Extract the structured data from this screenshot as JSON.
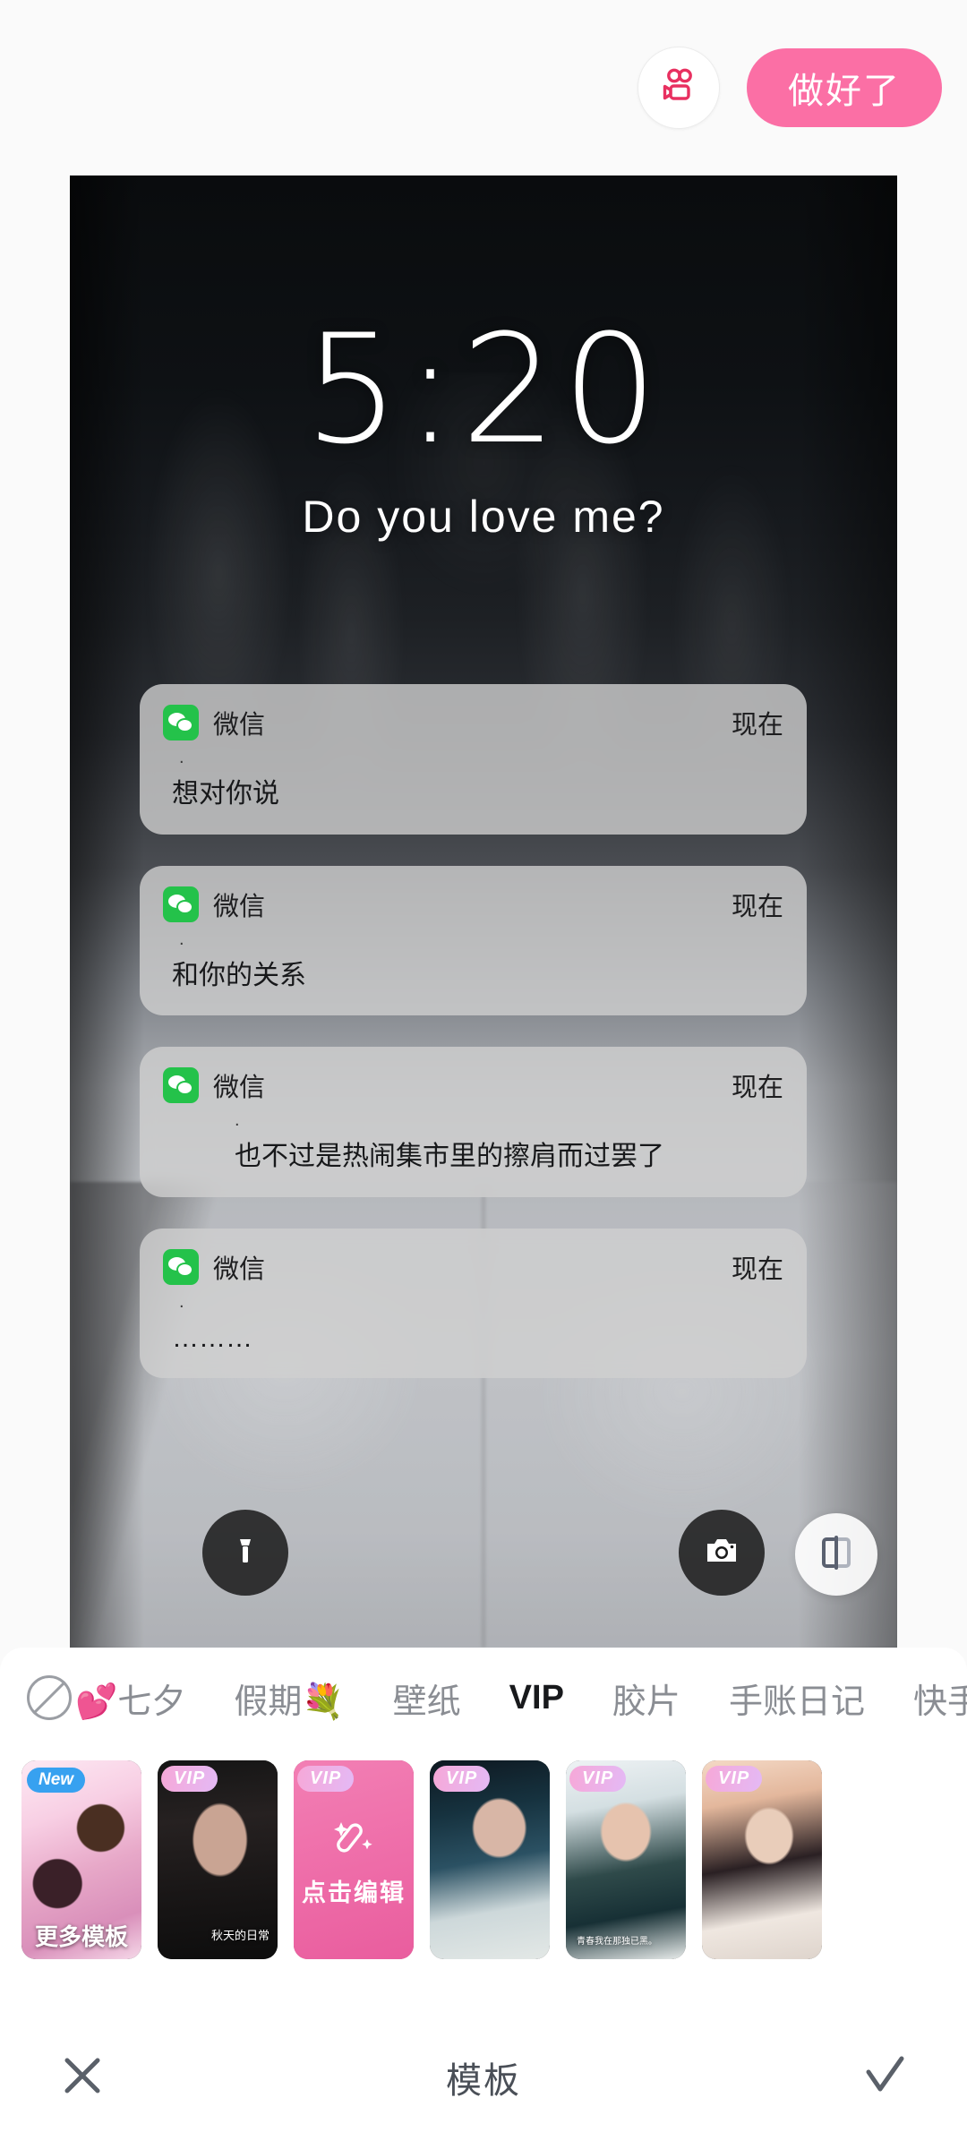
{
  "topbar": {
    "video_icon": "video-camera-icon",
    "done_label": "做好了"
  },
  "preview": {
    "lock_time": "5:20",
    "lock_subtitle": "Do you love me?",
    "notifications": [
      {
        "app": "微信",
        "time": "现在",
        "dot": ".",
        "body": "想对你说",
        "indent": "indent-1"
      },
      {
        "app": "微信",
        "time": "现在",
        "dot": ".",
        "body": "和你的关系",
        "indent": "indent-1"
      },
      {
        "app": "微信",
        "time": "现在",
        "dot": ".",
        "body": "也不过是热闹集市里的擦肩而过罢了",
        "indent": "indent-2"
      },
      {
        "app": "微信",
        "time": "现在",
        "dot": ".",
        "body": "………",
        "indent": "indent-1"
      }
    ],
    "flashlight_icon": "flashlight-icon",
    "camera_icon": "camera-icon",
    "compare_icon": "compare-split-icon"
  },
  "panel": {
    "tabs": [
      {
        "label": "💕七夕",
        "active": false,
        "icon": "no-template-icon"
      },
      {
        "label": "假期💐",
        "active": false
      },
      {
        "label": "壁纸",
        "active": false
      },
      {
        "label": "VIP",
        "active": true
      },
      {
        "label": "胶片",
        "active": false
      },
      {
        "label": "手账日记",
        "active": false
      },
      {
        "label": "快手烛",
        "active": false
      }
    ],
    "thumbnails": [
      {
        "badge": "New",
        "badge_type": "new",
        "caption": "更多模板",
        "caption_style": "big",
        "art": "art-1",
        "selected": false
      },
      {
        "badge": "VIP",
        "badge_type": "vip",
        "caption": "秋天的日常",
        "caption_style": "small",
        "art": "art-2",
        "selected": false
      },
      {
        "badge": "VIP",
        "badge_type": "vip",
        "caption": "点击编辑",
        "caption_style": "edit",
        "art": "art-3",
        "selected": true
      },
      {
        "badge": "VIP",
        "badge_type": "vip",
        "caption": "",
        "caption_style": "none",
        "art": "art-4",
        "selected": false
      },
      {
        "badge": "VIP",
        "badge_type": "vip",
        "caption": "青春我在那独已黑。",
        "caption_style": "tiny",
        "art": "art-5",
        "selected": false
      },
      {
        "badge": "VIP",
        "badge_type": "vip",
        "caption": "",
        "caption_style": "none",
        "art": "art-6",
        "selected": false
      }
    ]
  },
  "bottombar": {
    "cancel_icon": "close-icon",
    "title": "模板",
    "confirm_icon": "check-icon"
  },
  "colors": {
    "accent_pink": "#fb6fa5",
    "badge_blue": "#37a1f0",
    "wechat_green": "#24c24a",
    "page_bg": "#fafafa"
  }
}
